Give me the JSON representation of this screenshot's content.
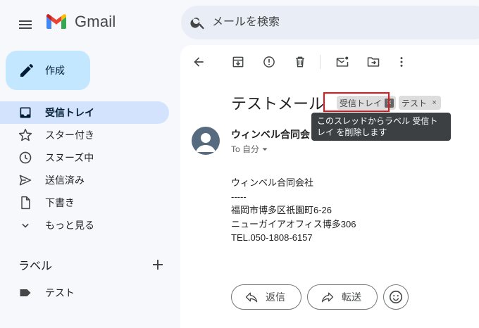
{
  "app": {
    "name": "Gmail"
  },
  "search": {
    "placeholder": "メールを検索"
  },
  "compose": {
    "label": "作成"
  },
  "sidebar": {
    "items": [
      {
        "label": "受信トレイ",
        "icon": "inbox-icon",
        "active": true
      },
      {
        "label": "スター付き",
        "icon": "star-icon"
      },
      {
        "label": "スヌーズ中",
        "icon": "clock-icon"
      },
      {
        "label": "送信済み",
        "icon": "send-icon"
      },
      {
        "label": "下書き",
        "icon": "draft-icon"
      },
      {
        "label": "もっと見る",
        "icon": "chevron-down-icon"
      }
    ],
    "labels_title": "ラベル",
    "labels": [
      {
        "label": "テスト",
        "icon": "label-tag-icon"
      }
    ]
  },
  "toolbar": {
    "icons": [
      "back-arrow-icon",
      "archive-icon",
      "report-spam-icon",
      "delete-icon",
      "mark-unread-icon",
      "move-to-icon",
      "more-vert-icon"
    ]
  },
  "message": {
    "subject": "テストメール",
    "chips": [
      {
        "label": "受信トレイ",
        "close": "×"
      },
      {
        "label": "テスト",
        "close": "×"
      }
    ],
    "tooltip": "このスレッドからラベル 受信トレイ を削除します",
    "sender": "ウィンベル合同会",
    "to": "To 自分",
    "body": [
      "ウィンベル合同会社",
      "-----",
      "福岡市博多区祇園町6-26",
      "ニューガイアオフィス博多306",
      "TEL.050-1808-6157"
    ]
  },
  "actions": {
    "reply": "返信",
    "forward": "転送"
  },
  "colors": {
    "compose": "#c2e7ff",
    "active_nav": "#d3e3fd",
    "highlight": "#e8141c",
    "tooltip": "#3c4043"
  }
}
